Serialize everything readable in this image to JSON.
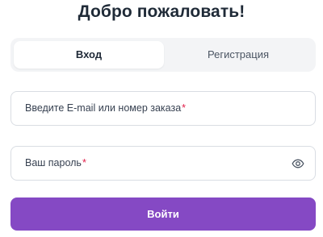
{
  "title": "Добро пожаловать!",
  "tabs": [
    {
      "label": "Вход",
      "active": true
    },
    {
      "label": "Регистрация",
      "active": false
    }
  ],
  "fields": {
    "email": {
      "label": "Введите E-mail или номер заказа",
      "required_mark": "*"
    },
    "password": {
      "label": "Ваш пароль",
      "required_mark": "*",
      "icon": "eye-icon"
    }
  },
  "submit": {
    "label": "Войти"
  },
  "colors": {
    "accent": "#8549c4",
    "required": "#e11d48",
    "title": "#1f2a37"
  }
}
